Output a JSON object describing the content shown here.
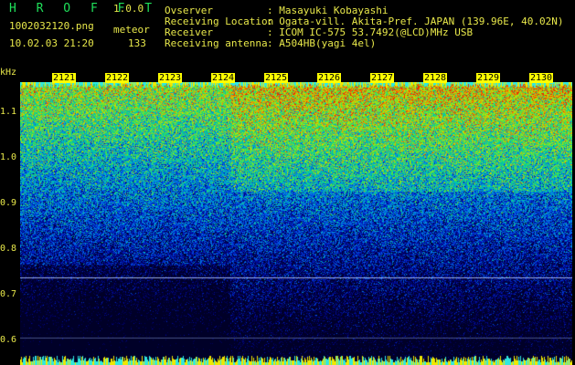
{
  "app": {
    "title": "H R O F F T",
    "version": "1.0.0"
  },
  "file": {
    "name": "1002032120.png",
    "datetime": "10.02.03 21:20",
    "mode_label": "meteor",
    "count": "133"
  },
  "info": {
    "observer_label": "Ovserver",
    "observer_value": ": Masayuki Kobayashi",
    "location_label": "Receiving Location",
    "location_value": ": Ogata-vill. Akita-Pref. JAPAN (139.96E, 40.02N)",
    "receiver_label": "Receiver",
    "receiver_value": ": ICOM IC-575 53.7492(@LCD)MHz USB",
    "antenna_label": "Receiving antenna",
    "antenna_value": ": A504HB(yagi 4el)"
  },
  "axis": {
    "y_unit": "kHz",
    "y_ticks": [
      "1.1",
      "1.0",
      "0.9",
      "0.8",
      "0.7",
      "0.6"
    ],
    "x_ticks": [
      "2121",
      "2122",
      "2123",
      "2124",
      "2125",
      "2126",
      "2127",
      "2128",
      "2129",
      "2130"
    ]
  },
  "colors": {
    "label": "#e8e84a",
    "title": "#1fe05a",
    "tick_bg": "#ffff00"
  }
}
